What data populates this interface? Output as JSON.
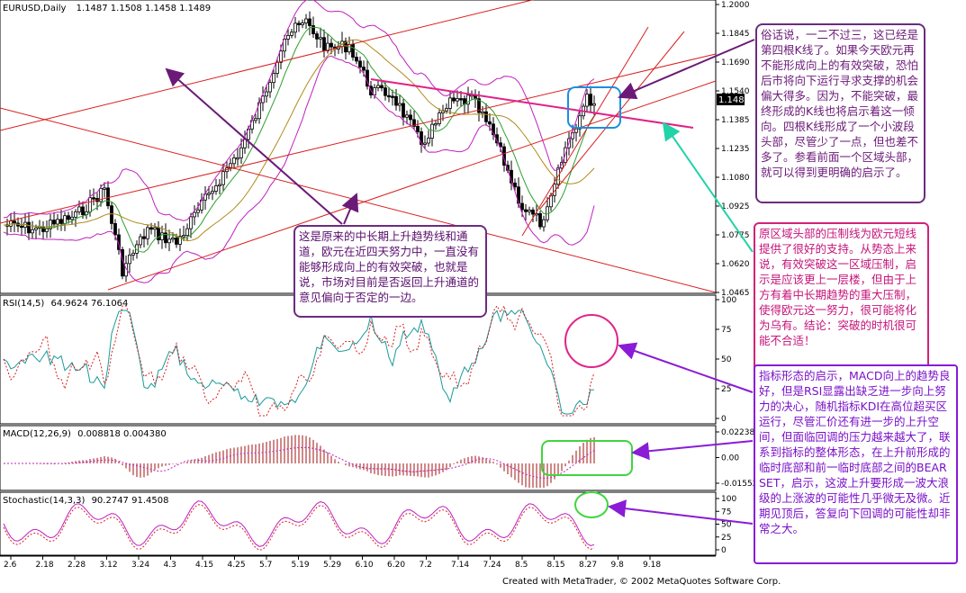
{
  "main_panel": {
    "title": "EURUSD,Daily",
    "ohlc": "1.1487 1.1508 1.1458 1.1489",
    "price_ticks": [
      "1.2000",
      "1.1845",
      "1.1690",
      "1.1540",
      "1.1385",
      "1.1235",
      "1.1080",
      "1.0925",
      "1.0775",
      "1.0620",
      "1.0465"
    ],
    "last_price": "1.1489"
  },
  "rsi_panel": {
    "title": "RSI(14,5)",
    "values": "64.9624 76.1064",
    "ticks": [
      "100",
      "75",
      "50",
      "25",
      "0"
    ]
  },
  "macd_panel": {
    "title": "MACD(12,26,9)",
    "values": "0.008818 0.004380",
    "ticks": [
      "0.02238",
      "0.00",
      "-0.01552"
    ]
  },
  "stoch_panel": {
    "title": "Stochastic(14,3,3)",
    "values": "90.2747 91.4508",
    "ticks": [
      "100",
      "75",
      "50",
      "25",
      "0"
    ]
  },
  "x_axis": {
    "labels": [
      "2.6",
      "2.18",
      "2.28",
      "3.12",
      "3.24",
      "4.3",
      "4.15",
      "4.25",
      "5.7",
      "5.19",
      "5.29",
      "6.10",
      "6.20",
      "7.2",
      "7.14",
      "7.24",
      "8.5",
      "8.15",
      "8.27",
      "9.8",
      "9.18"
    ]
  },
  "annotations": {
    "top_right": "俗话说，一二不过三，这已经是第四根K线了。如果今天欧元再不能形成向上的有效突破，恐怕后市将向下运行寻求支撑的机会偏大得多。因为，不能突破，最终形成的K线也将启示着这一倾向。四根K线形成了一个小波段头部，尽管少了一点，但也差不多了。参看前面一个区域头部，就可以得到更明确的启示了。",
    "middle_right": "原区域头部的压制线为欧元短线提供了很好的支持。从势态上来说，有效突破这一区域压制，启示是应该更上一层楼，但由于上方有着中长期趋势的重大压制，使得欧元这一努力，很可能将化为乌有。结论：突破的时机很可能不合适！",
    "bottom_right": "指标形态的启示，MACD向上的趋势良好，但是RSI显露出缺乏进一步向上努力的决心，随机指标KDI在高位超买区运行，尽管汇价还有进一步的上升空间，但面临回调的压力越来越大了，联系到指标的整体形态，在上升前形成的临时底部和前一临时底部之间的BEAR SET，启示，这波上升要形成一波大浪级的上涨波的可能性几乎微无及微。近期见顶后，答复向下回调的可能性却非常之大。",
    "center": "这是原来的中长期上升趋势线和通道，欧元在近四天努力中，一直没有能够形成向上的有效突破，也就是说，市场对目前是否返回上升通道的意见偏向于否定的一边。"
  },
  "footer": "Created with MetaTrader, © 2002 MetaQuotes Software Corp."
}
